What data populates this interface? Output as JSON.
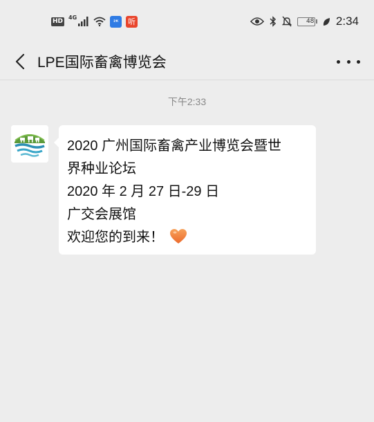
{
  "status_bar": {
    "hd_label": "HD",
    "network_label": "4G",
    "app_badge_1": "²ᴷ",
    "app_badge_2": "听",
    "battery_level": "48",
    "time": "2:34"
  },
  "nav": {
    "title": "LPE国际畜禽博览会"
  },
  "chat": {
    "timestamp": "下午2:33",
    "message_lines": [
      "2020 广州国际畜禽产业博览会暨世",
      "界种业论坛",
      "2020 年 2 月 27 日-29 日",
      "广交会展馆",
      "欢迎您的到来！"
    ],
    "emoji": "heart-icon"
  },
  "colors": {
    "background": "#ededed",
    "bubble": "#ffffff",
    "heart": "#f07a3a",
    "logo_green": "#5c9a3a",
    "logo_blue": "#2a8fb4"
  }
}
